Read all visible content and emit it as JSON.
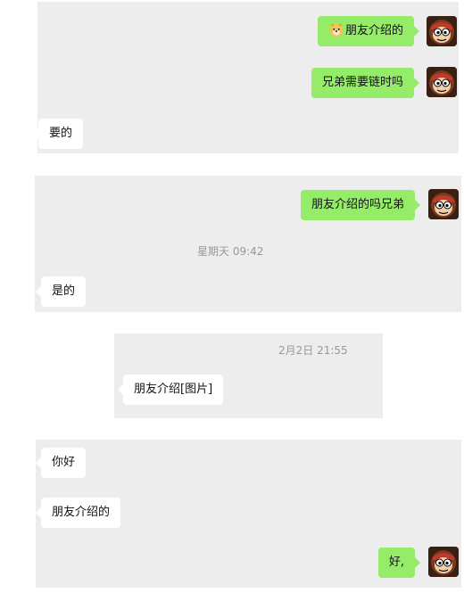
{
  "panel1": {
    "messages": [
      {
        "text": "朋友介绍的",
        "sender": "self",
        "emoji": "doge-emoji"
      },
      {
        "text": "兄弟需要链时吗",
        "sender": "self"
      },
      {
        "text": "要的",
        "sender": "other"
      }
    ]
  },
  "panel2": {
    "messages": [
      {
        "text": "朋友介绍的吗兄弟",
        "sender": "self"
      },
      {
        "text": "是的",
        "sender": "other"
      }
    ],
    "timestamp": "星期天 09:42"
  },
  "panel3": {
    "timestamp": "2月2日 21:55",
    "messages": [
      {
        "text": "朋友介绍[图片]",
        "sender": "other"
      }
    ]
  },
  "panel4": {
    "messages": [
      {
        "text": "你好",
        "sender": "other"
      },
      {
        "text": "朋友介绍的",
        "sender": "other"
      },
      {
        "text": "好,",
        "sender": "self"
      }
    ]
  },
  "colors": {
    "self_bubble": "#95ec69",
    "other_bubble": "#ffffff",
    "panel_bg": "#ededed",
    "timestamp_text": "#999999"
  },
  "icons": {
    "avatar": "monkey-avatar-icon",
    "emoji": "doge-emoji-icon"
  }
}
